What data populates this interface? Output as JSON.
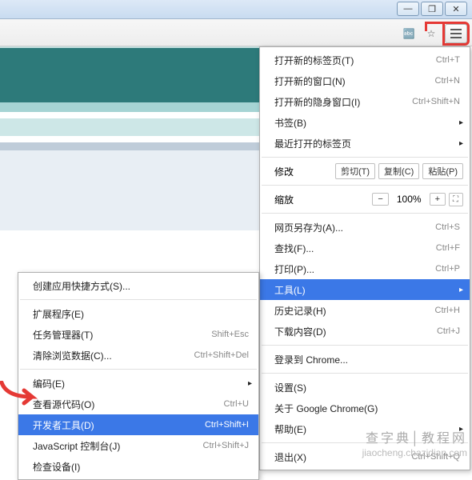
{
  "window": {
    "min": "—",
    "max": "❐",
    "close": "✕"
  },
  "main_menu": {
    "new_tab": {
      "label": "打开新的标签页(T)",
      "shortcut": "Ctrl+T"
    },
    "new_window": {
      "label": "打开新的窗口(N)",
      "shortcut": "Ctrl+N"
    },
    "new_incognito": {
      "label": "打开新的隐身窗口(I)",
      "shortcut": "Ctrl+Shift+N"
    },
    "bookmarks": {
      "label": "书签(B)"
    },
    "recent_tabs": {
      "label": "最近打开的标签页"
    },
    "edit": {
      "label": "修改",
      "cut": "剪切(T)",
      "copy": "复制(C)",
      "paste": "粘贴(P)"
    },
    "zoom": {
      "label": "缩放",
      "minus": "−",
      "value": "100%",
      "plus": "+",
      "full": "⛶"
    },
    "save_as": {
      "label": "网页另存为(A)...",
      "shortcut": "Ctrl+S"
    },
    "find": {
      "label": "查找(F)...",
      "shortcut": "Ctrl+F"
    },
    "print": {
      "label": "打印(P)...",
      "shortcut": "Ctrl+P"
    },
    "tools": {
      "label": "工具(L)"
    },
    "history": {
      "label": "历史记录(H)",
      "shortcut": "Ctrl+H"
    },
    "downloads": {
      "label": "下载内容(D)",
      "shortcut": "Ctrl+J"
    },
    "signin": {
      "label": "登录到 Chrome..."
    },
    "settings": {
      "label": "设置(S)"
    },
    "about": {
      "label": "关于 Google Chrome(G)"
    },
    "help": {
      "label": "帮助(E)"
    },
    "exit": {
      "label": "退出(X)",
      "shortcut": "Ctrl+Shift+Q"
    }
  },
  "sub_menu": {
    "create_shortcut": {
      "label": "创建应用快捷方式(S)..."
    },
    "extensions": {
      "label": "扩展程序(E)"
    },
    "task_manager": {
      "label": "任务管理器(T)",
      "shortcut": "Shift+Esc"
    },
    "clear_data": {
      "label": "清除浏览数据(C)...",
      "shortcut": "Ctrl+Shift+Del"
    },
    "encoding": {
      "label": "编码(E)"
    },
    "view_source": {
      "label": "查看源代码(O)",
      "shortcut": "Ctrl+U"
    },
    "dev_tools": {
      "label": "开发者工具(D)",
      "shortcut": "Ctrl+Shift+I"
    },
    "js_console": {
      "label": "JavaScript 控制台(J)",
      "shortcut": "Ctrl+Shift+J"
    },
    "inspect_devices": {
      "label": "检查设备(I)"
    }
  },
  "watermark": {
    "main": "查字典│教程网",
    "sub": "jiaocheng.chazidian.com"
  }
}
